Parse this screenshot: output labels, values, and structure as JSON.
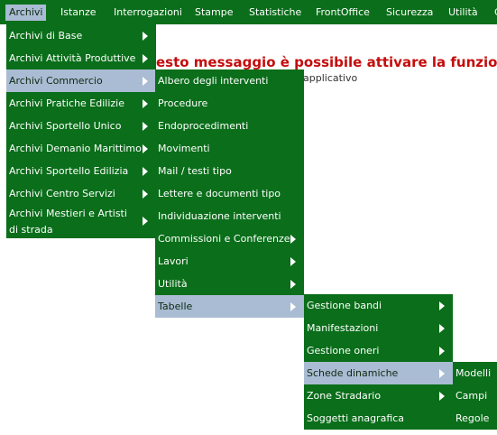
{
  "menubar": {
    "items": [
      {
        "label": "Archivi"
      },
      {
        "label": "Istanze"
      },
      {
        "label": "Interrogazioni"
      },
      {
        "label": "Stampe"
      },
      {
        "label": "Statistiche"
      },
      {
        "label": "FrontOffice"
      },
      {
        "label": "Sicurezza"
      },
      {
        "label": "Utilità"
      },
      {
        "label": "Gu"
      }
    ]
  },
  "background": {
    "message": "esto messaggio è possibile attivare la funzionalità e",
    "subtext": "applicativo"
  },
  "menus": {
    "archivi": [
      {
        "label": "Archivi di Base"
      },
      {
        "label": "Archivi Attività Produttive"
      },
      {
        "label": "Archivi Commercio"
      },
      {
        "label": "Archivi Pratiche Edilizie"
      },
      {
        "label": "Archivi Sportello Unico"
      },
      {
        "label": "Archivi Demanio Marittimo"
      },
      {
        "label": "Archivi Sportello Edilizia"
      },
      {
        "label": "Archivi Centro Servizi"
      },
      {
        "label": "Archivi Mestieri e Artisti di strada"
      }
    ],
    "commercio": [
      {
        "label": "Albero degli interventi"
      },
      {
        "label": "Procedure"
      },
      {
        "label": "Endoprocedimenti"
      },
      {
        "label": "Movimenti"
      },
      {
        "label": "Mail / testi tipo"
      },
      {
        "label": "Lettere e documenti tipo"
      },
      {
        "label": "Individuazione interventi"
      },
      {
        "label": "Commissioni e Conferenze"
      },
      {
        "label": "Lavori"
      },
      {
        "label": "Utilità"
      },
      {
        "label": "Tabelle"
      }
    ],
    "tabelle": [
      {
        "label": "Gestione bandi"
      },
      {
        "label": "Manifestazioni"
      },
      {
        "label": "Gestione oneri"
      },
      {
        "label": "Schede dinamiche"
      },
      {
        "label": "Zone Stradario"
      },
      {
        "label": "Soggetti anagrafica"
      }
    ],
    "schede": [
      {
        "label": "Modelli"
      },
      {
        "label": "Campi"
      },
      {
        "label": "Regole"
      }
    ]
  },
  "colors": {
    "menu_bg": "#0a6e1a",
    "highlight": "#a9bcd3",
    "message_red": "#c40c0c"
  }
}
